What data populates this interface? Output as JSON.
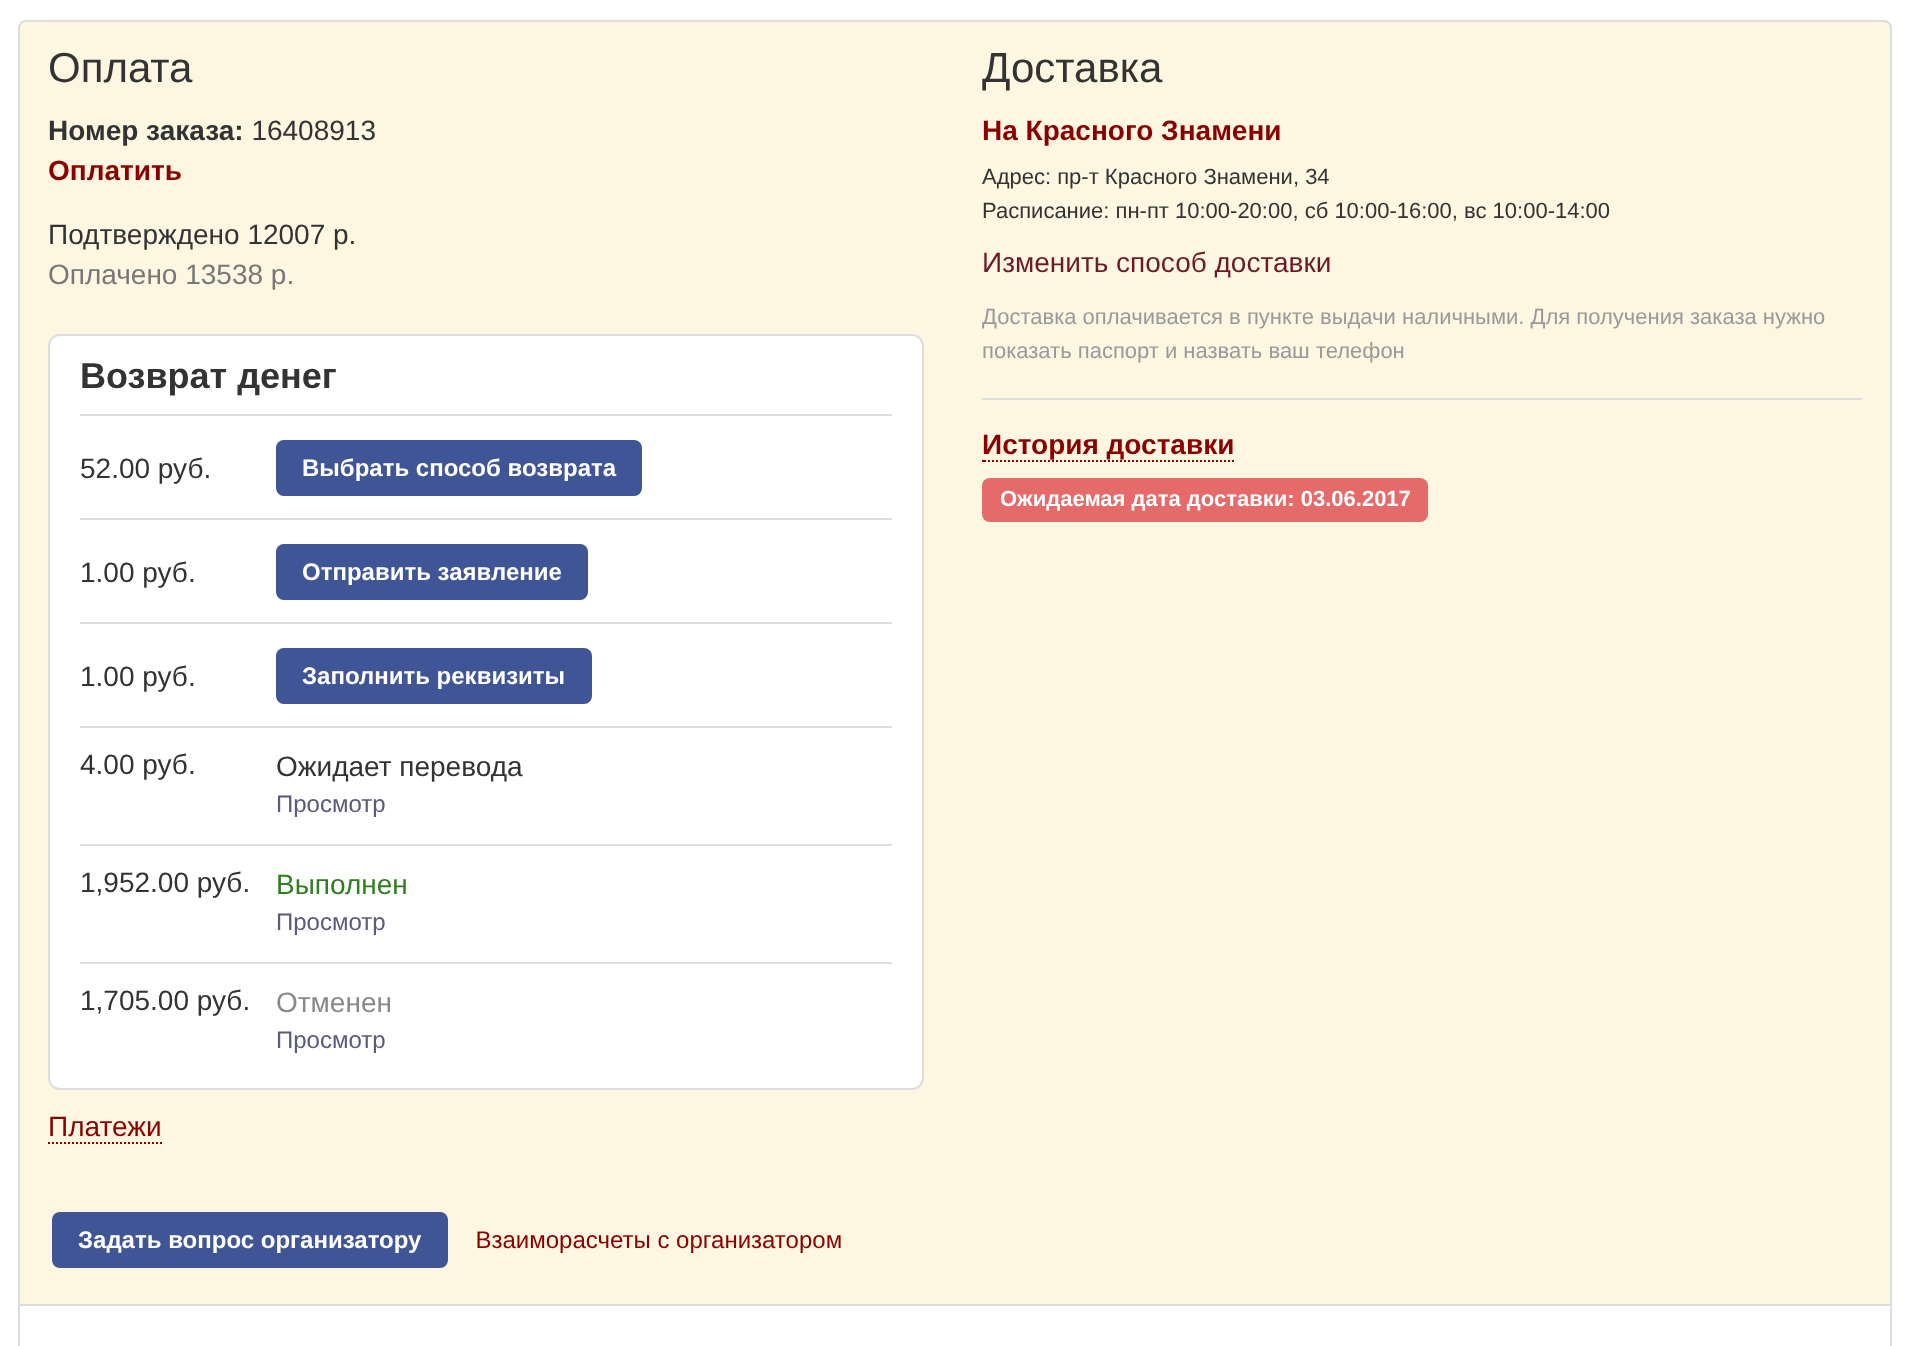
{
  "payment": {
    "title": "Оплата",
    "order_label": "Номер заказа:",
    "order_number": "16408913",
    "pay_link": "Оплатить",
    "confirmed": "Подтверждено 12007 р.",
    "paid": "Оплачено 13538 р."
  },
  "refund": {
    "title": "Возврат денег",
    "rows": [
      {
        "amount": "52.00 руб.",
        "kind": "button",
        "label": "Выбрать способ возврата"
      },
      {
        "amount": "1.00 руб.",
        "kind": "button",
        "label": "Отправить заявление"
      },
      {
        "amount": "1.00 руб.",
        "kind": "button",
        "label": "Заполнить реквизиты"
      },
      {
        "amount": "4.00 руб.",
        "kind": "status",
        "color": "#333333",
        "label": "Ожидает перевода",
        "link": "Просмотр"
      },
      {
        "amount": "1,952.00 руб.",
        "kind": "status",
        "color": "#2e7d1e",
        "label": "Выполнен",
        "link": "Просмотр"
      },
      {
        "amount": "1,705.00 руб.",
        "kind": "status",
        "color": "#888888",
        "label": "Отменен",
        "link": "Просмотр"
      }
    ]
  },
  "payments_link": "Платежи",
  "delivery": {
    "title": "Доставка",
    "point": "На Красного Знамени",
    "address": "Адрес: пр-т Красного Знамени, 34",
    "schedule": "Расписание: пн-пт 10:00-20:00, сб 10:00-16:00, вс 10:00-14:00",
    "change_link": "Изменить способ доставки",
    "note": "Доставка оплачивается в пункте выдачи наличными. Для получения заказа нужно показать паспорт и назвать ваш телефон",
    "history_link": "История доставки",
    "expected_badge": "Ожидаемая дата доставки: 03.06.2017"
  },
  "footer": {
    "ask_button": "Задать вопрос организатору",
    "settlements_link": "Взаиморасчеты с организатором"
  }
}
